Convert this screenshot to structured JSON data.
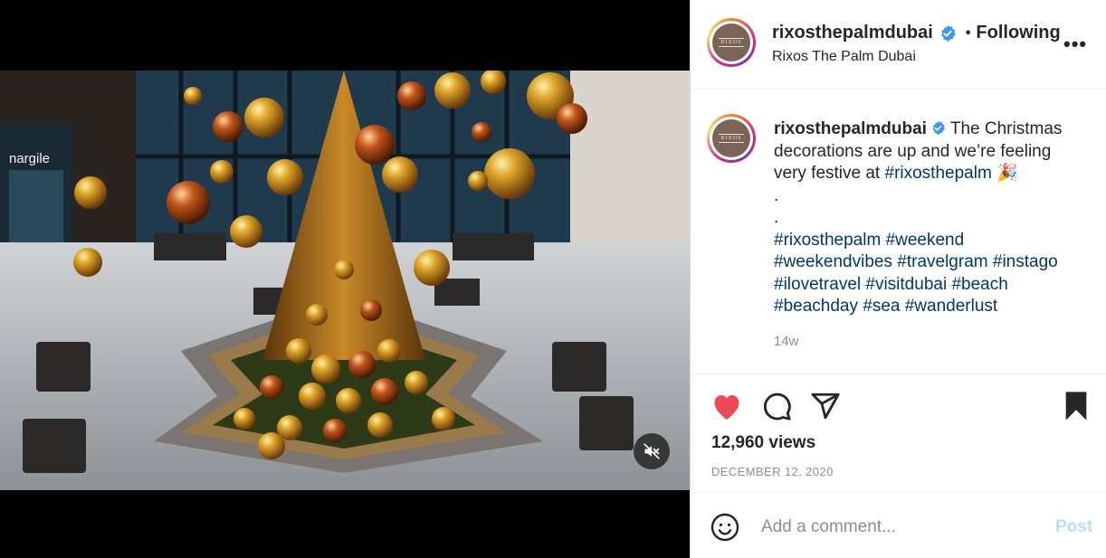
{
  "post": {
    "username": "rixosthepalmdubai",
    "location": "Rixos The Palm Dubai",
    "follow_dot": "•",
    "follow_label": "Following",
    "more_label": "•••",
    "avatar_logo_text": "RIXOS"
  },
  "caption": {
    "username": "rixosthepalmdubai",
    "text": " The Christmas decorations are up and we’re feeling very festive at ",
    "first_tag": "#rixosthepalm",
    "emoji": "🎉",
    "dot1": ".",
    "dot2": ".",
    "tags": [
      "#rixosthepalm",
      "#weekend",
      "#weekendvibes",
      "#travelgram",
      "#instago",
      "#ilovetravel",
      "#visitdubai",
      "#beach",
      "#beachday",
      "#sea",
      "#wanderlust"
    ],
    "time": "14w"
  },
  "video_overlay": {
    "sign_text": "nargile"
  },
  "stats": {
    "views": "12,960 views",
    "date": "DECEMBER 12, 2020"
  },
  "comment": {
    "placeholder": "Add a comment...",
    "post_label": "Post"
  },
  "colors": {
    "like_red": "#ed4956",
    "link_blue": "#00376b",
    "verified_blue": "#3897f0",
    "post_disabled": "#b2dffc"
  },
  "icons": [
    "heart-icon",
    "comment-icon",
    "share-icon",
    "bookmark-icon",
    "mute-icon",
    "emoji-icon",
    "verified-icon"
  ]
}
